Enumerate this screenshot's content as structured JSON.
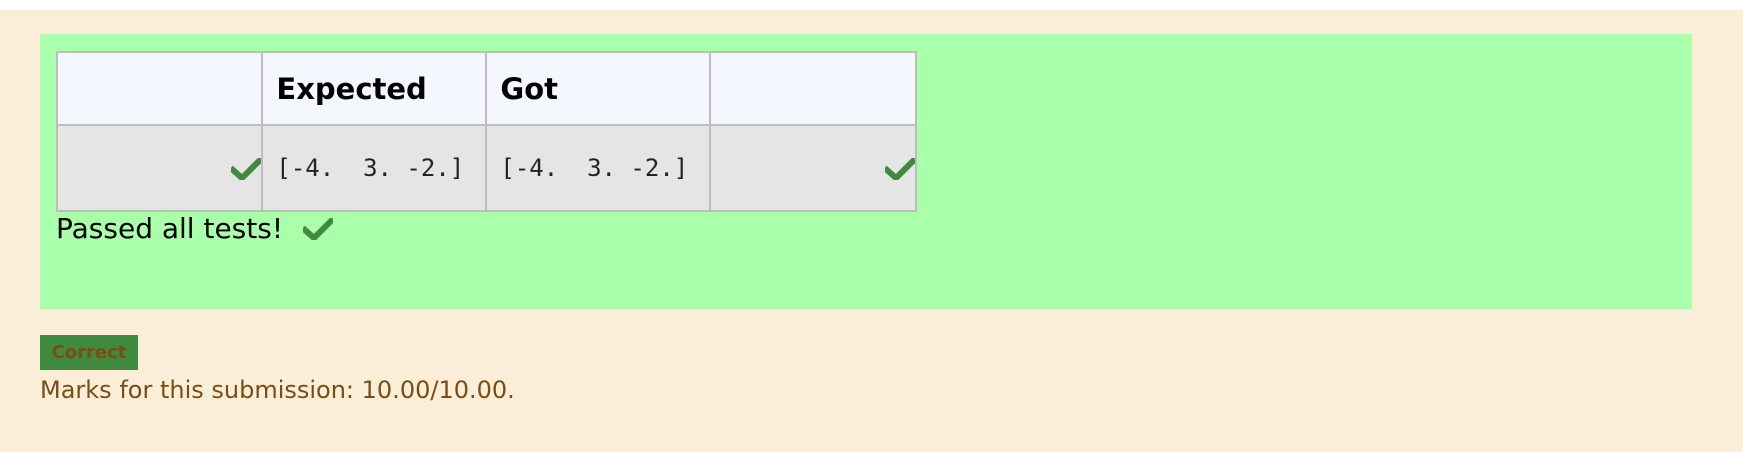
{
  "results_table": {
    "headers": [
      "",
      "Expected",
      "Got",
      ""
    ],
    "rows": [
      {
        "status_icon": "check-icon",
        "expected": "[-4.  3. -2.]",
        "got": "[-4.  3. -2.]",
        "result_icon": "check-icon"
      }
    ]
  },
  "summary": {
    "passed_text": "Passed all tests!",
    "icon": "check-icon"
  },
  "outcome": {
    "badge_label": "Correct",
    "marks_text": "Marks for this submission: 10.00/10.00."
  },
  "colors": {
    "page_background": "#fbeed9",
    "result_panel_background": "#aaffaa",
    "check_green": "#3f8a3f",
    "badge_background": "#3f8a3f",
    "marks_text": "#7a4d12"
  }
}
